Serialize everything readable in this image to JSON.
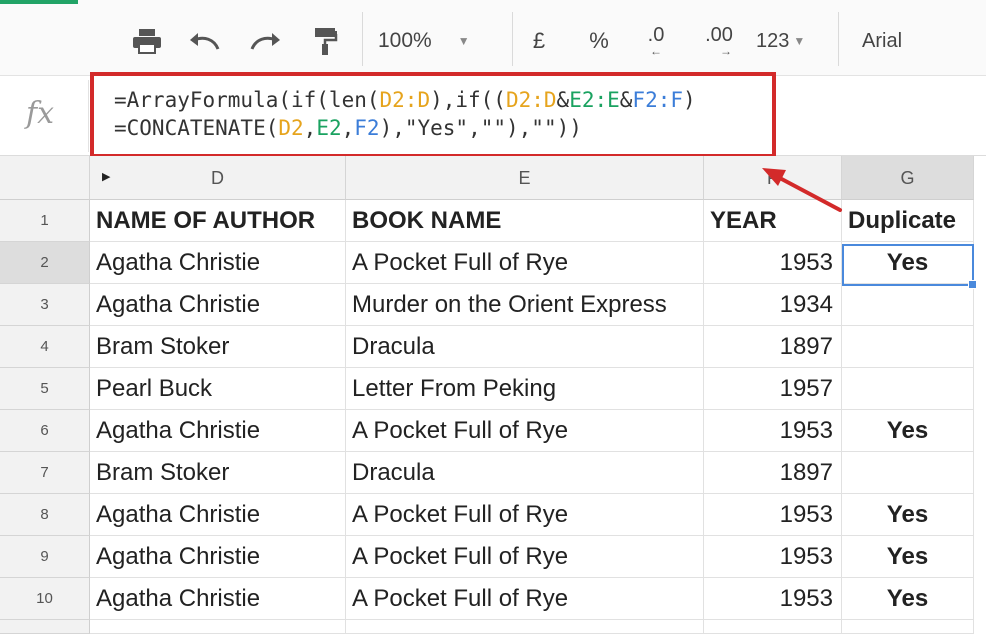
{
  "toolbar": {
    "zoom": "100%",
    "currency": "£",
    "percent": "%",
    "decrease_decimals": ".0",
    "increase_decimals": ".00",
    "number_format": "123",
    "font": "Arial",
    "icons": [
      "print-icon",
      "undo-icon",
      "redo-icon",
      "paint-format-icon"
    ]
  },
  "formula_bar": {
    "fx_label": "fx",
    "line1": [
      {
        "t": "=ArrayFormula(if(len(",
        "c": ""
      },
      {
        "t": "D2:D",
        "c": "tk-o"
      },
      {
        "t": "),if((",
        "c": ""
      },
      {
        "t": "D2:D",
        "c": "tk-o"
      },
      {
        "t": "&",
        "c": ""
      },
      {
        "t": "E2:E",
        "c": "tk-g"
      },
      {
        "t": "&",
        "c": ""
      },
      {
        "t": "F2:F",
        "c": "tk-b"
      },
      {
        "t": ")",
        "c": ""
      }
    ],
    "line2": [
      {
        "t": "=CONCATENATE(",
        "c": ""
      },
      {
        "t": "D2",
        "c": "tk-o"
      },
      {
        "t": ",",
        "c": ""
      },
      {
        "t": "E2",
        "c": "tk-g"
      },
      {
        "t": ",",
        "c": ""
      },
      {
        "t": "F2",
        "c": "tk-b"
      },
      {
        "t": "),\"Yes\",\"\"),\"\"))",
        "c": ""
      }
    ]
  },
  "sheet": {
    "columns": [
      "D",
      "E",
      "F",
      "G"
    ],
    "rows": [
      {
        "n": "1",
        "cells": [
          "NAME OF AUTHOR",
          "BOOK NAME",
          "YEAR",
          "Duplicate"
        ]
      },
      {
        "n": "2",
        "cells": [
          "Agatha Christie",
          "A Pocket Full of Rye",
          "1953",
          "Yes"
        ]
      },
      {
        "n": "3",
        "cells": [
          "Agatha Christie",
          "Murder on the Orient Express",
          "1934",
          ""
        ]
      },
      {
        "n": "4",
        "cells": [
          "Bram Stoker",
          "Dracula",
          "1897",
          ""
        ]
      },
      {
        "n": "5",
        "cells": [
          "Pearl Buck",
          "Letter From Peking",
          "1957",
          ""
        ]
      },
      {
        "n": "6",
        "cells": [
          "Agatha Christie",
          "A Pocket Full of Rye",
          "1953",
          "Yes"
        ]
      },
      {
        "n": "7",
        "cells": [
          "Bram Stoker",
          "Dracula",
          "1897",
          ""
        ]
      },
      {
        "n": "8",
        "cells": [
          "Agatha Christie",
          "A Pocket Full of Rye",
          "1953",
          "Yes"
        ]
      },
      {
        "n": "9",
        "cells": [
          "Agatha Christie",
          "A Pocket Full of Rye",
          "1953",
          "Yes"
        ]
      },
      {
        "n": "10",
        "cells": [
          "Agatha Christie",
          "A Pocket Full of Rye",
          "1953",
          "Yes"
        ]
      }
    ],
    "active_cell": "G2"
  },
  "colors": {
    "highlight_border": "#d32a2a",
    "selection": "#4a89dc",
    "accent": "#21a366"
  }
}
